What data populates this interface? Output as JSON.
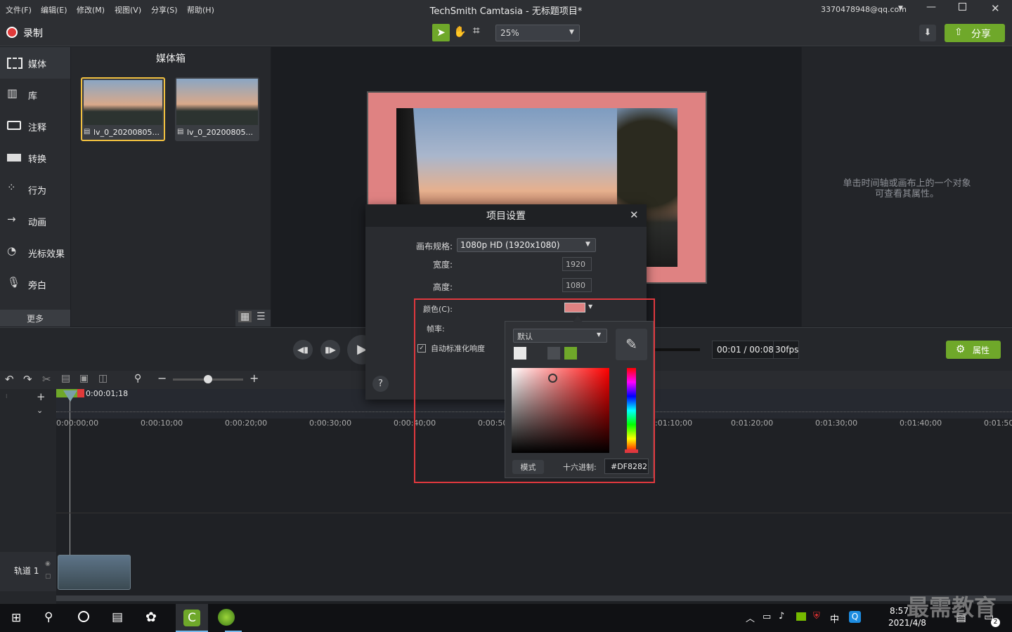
{
  "app": {
    "title": "TechSmith Camtasia - 无标题项目*",
    "account": "3370478948@qq.com"
  },
  "menu": [
    "文件(F)",
    "编辑(E)",
    "修改(M)",
    "视图(V)",
    "分享(S)",
    "帮助(H)"
  ],
  "toolbar": {
    "record": "录制",
    "zoom": "25%",
    "share": "分享"
  },
  "nav": [
    {
      "label": "媒体",
      "icon": "film-icon"
    },
    {
      "label": "库",
      "icon": "library-icon"
    },
    {
      "label": "注释",
      "icon": "annotation-icon"
    },
    {
      "label": "转换",
      "icon": "transition-icon"
    },
    {
      "label": "行为",
      "icon": "behavior-icon"
    },
    {
      "label": "动画",
      "icon": "animation-icon"
    },
    {
      "label": "光标效果",
      "icon": "cursor-effect-icon"
    },
    {
      "label": "旁白",
      "icon": "microphone-icon"
    }
  ],
  "nav_more": "更多",
  "bin": {
    "title": "媒体箱",
    "items": [
      "lv_0_20200805...",
      "lv_0_20200805..."
    ]
  },
  "props": {
    "hint1": "单击时间轴或画布上的一个对象",
    "hint2": "可查看其属性。",
    "button": "属性"
  },
  "dialog": {
    "title": "项目设置",
    "canvas_label": "画布规格:",
    "canvas_value": "1080p HD (1920x1080)",
    "width_label": "宽度:",
    "width": "1920",
    "height_label": "高度:",
    "height": "1080",
    "color_label": "颜色(C):",
    "fps_label": "帧率:",
    "auto_label": "自动标准化响度",
    "help": "?"
  },
  "picker": {
    "preset": "默认",
    "mode": "模式",
    "hex_label": "十六进制:",
    "hex": "#DF8282"
  },
  "transport": {
    "time": "00:01 / 00:08",
    "fps": "30fps"
  },
  "timeline": {
    "playhead": "0:00:01;18",
    "ticks": [
      "0:00:00;00",
      "0:00:10;00",
      "0:00:20;00",
      "0:00:30;00",
      "0:00:40;00",
      "0:00:50",
      "0:01:10;00",
      "0:01:20;00",
      "0:01:30;00",
      "0:01:40;00",
      "0:01:50;"
    ],
    "track": "轨道 1"
  },
  "taskbar": {
    "time": "8:57",
    "date": "2021/4/8",
    "ime": "中",
    "badge": "2"
  },
  "watermark": "最需教育",
  "colors": {
    "accent": "#6fa82a",
    "canvas_bg": "#DF8282",
    "highlight": "#e0383e"
  }
}
